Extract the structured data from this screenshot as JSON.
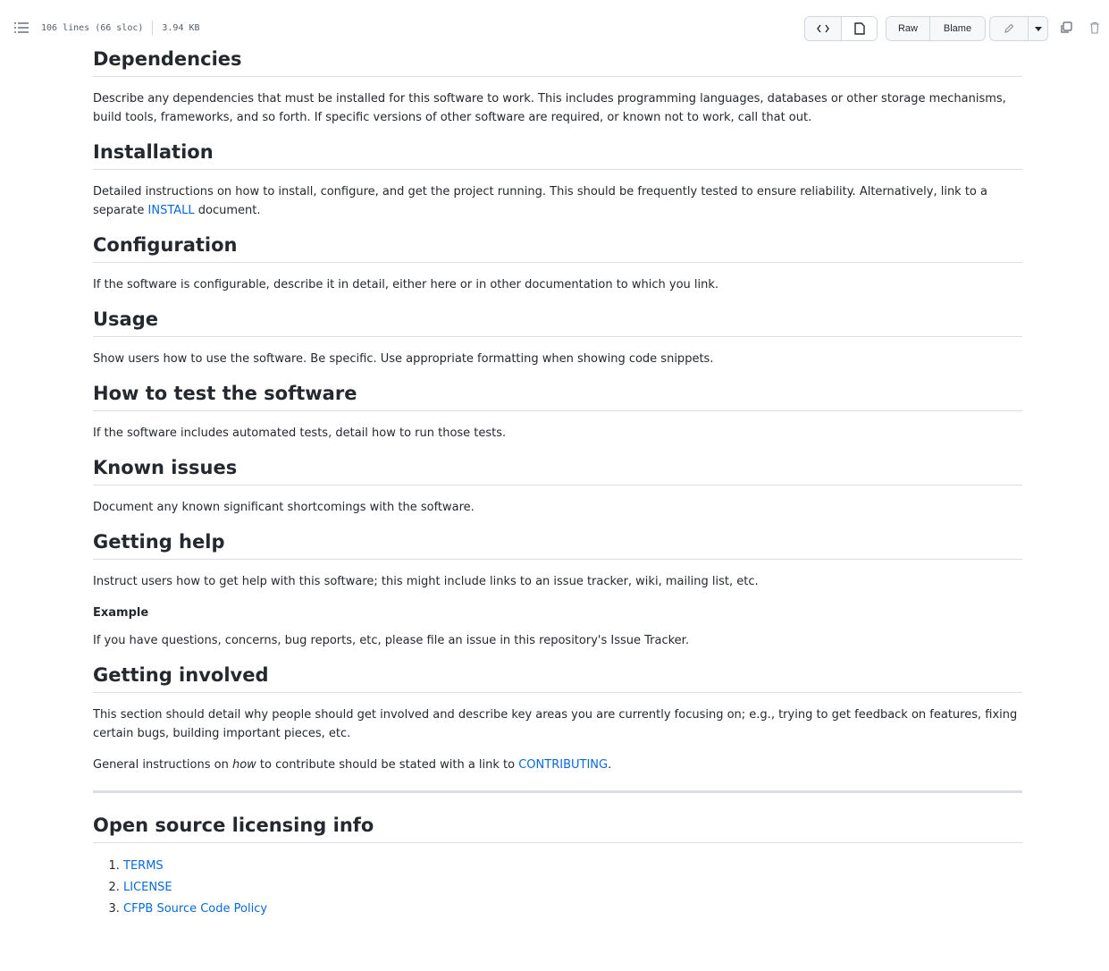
{
  "toolbar": {
    "file_stats": {
      "lines": "106 lines (66 sloc)",
      "size": "3.94 KB"
    },
    "raw_label": "Raw",
    "blame_label": "Blame"
  },
  "readme": {
    "sections": {
      "dependencies": {
        "heading": "Dependencies",
        "text": "Describe any dependencies that must be installed for this software to work. This includes programming languages, databases or other storage mechanisms, build tools, frameworks, and so forth. If specific versions of other software are required, or known not to work, call that out."
      },
      "installation": {
        "heading": "Installation",
        "text_before": "Detailed instructions on how to install, configure, and get the project running. This should be frequently tested to ensure reliability. Alternatively, link to a separate ",
        "link": "INSTALL",
        "text_after": " document."
      },
      "configuration": {
        "heading": "Configuration",
        "text": "If the software is configurable, describe it in detail, either here or in other documentation to which you link."
      },
      "usage": {
        "heading": "Usage",
        "text": "Show users how to use the software. Be specific. Use appropriate formatting when showing code snippets."
      },
      "testing": {
        "heading": "How to test the software",
        "text": "If the software includes automated tests, detail how to run those tests."
      },
      "known_issues": {
        "heading": "Known issues",
        "text": "Document any known significant shortcomings with the software."
      },
      "getting_help": {
        "heading": "Getting help",
        "text": "Instruct users how to get help with this software; this might include links to an issue tracker, wiki, mailing list, etc.",
        "example_heading": "Example",
        "example_text": "If you have questions, concerns, bug reports, etc, please file an issue in this repository's Issue Tracker."
      },
      "getting_involved": {
        "heading": "Getting involved",
        "text": "This section should detail why people should get involved and describe key areas you are currently focusing on; e.g., trying to get feedback on features, fixing certain bugs, building important pieces, etc.",
        "contribute_before": "General instructions on ",
        "contribute_em": "how",
        "contribute_middle": " to contribute should be stated with a link to ",
        "contribute_link": "CONTRIBUTING",
        "contribute_after": "."
      },
      "licensing": {
        "heading": "Open source licensing info",
        "items": [
          "TERMS",
          "LICENSE",
          "CFPB Source Code Policy"
        ]
      }
    }
  }
}
